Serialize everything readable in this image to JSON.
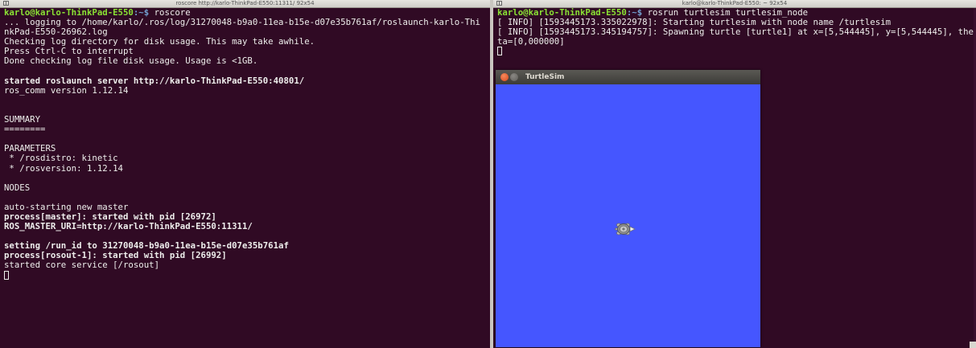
{
  "left_terminal": {
    "title": "roscore http://karlo-ThinkPad-E550:11311/ 92x54",
    "prompt_user": "karlo@karlo-ThinkPad-E550",
    "prompt_path": ":~$",
    "command": " roscore",
    "lines": [
      "... logging to /home/karlo/.ros/log/31270048-b9a0-11ea-b15e-d07e35b761af/roslaunch-karlo-Thi",
      "nkPad-E550-26962.log",
      "Checking log directory for disk usage. This may take awhile.",
      "Press Ctrl-C to interrupt",
      "Done checking log file disk usage. Usage is <1GB.",
      "",
      "started roslaunch server http://karlo-ThinkPad-E550:40801/",
      "ros_comm version 1.12.14",
      "",
      "",
      "SUMMARY",
      "========",
      "",
      "PARAMETERS",
      " * /rosdistro: kinetic",
      " * /rosversion: 1.12.14",
      "",
      "NODES",
      "",
      "auto-starting new master",
      "process[master]: started with pid [26972]",
      "ROS_MASTER_URI=http://karlo-ThinkPad-E550:11311/",
      "",
      "setting /run_id to 31270048-b9a0-11ea-b15e-d07e35b761af",
      "process[rosout-1]: started with pid [26992]",
      "started core service [/rosout]"
    ]
  },
  "right_terminal": {
    "title": "karlo@karlo-ThinkPad-E550: ~ 92x54",
    "prompt_user": "karlo@karlo-ThinkPad-E550",
    "prompt_path": ":~$",
    "command": " rosrun turtlesim turtlesim_node",
    "lines": [
      "[ INFO] [1593445173.335022978]: Starting turtlesim with node name /turtlesim",
      "[ INFO] [1593445173.345194757]: Spawning turtle [turtle1] at x=[5,544445], y=[5,544445], the",
      "ta=[0,000000]"
    ]
  },
  "turtlesim_window": {
    "title": "TurtleSim",
    "background_color": "#4556ff",
    "turtle_icon": "turtle-icon"
  },
  "colors": {
    "terminal_bg": "#300a24",
    "prompt_user": "#8ae234",
    "prompt_path": "#729fcf",
    "text": "#eeeeec"
  }
}
